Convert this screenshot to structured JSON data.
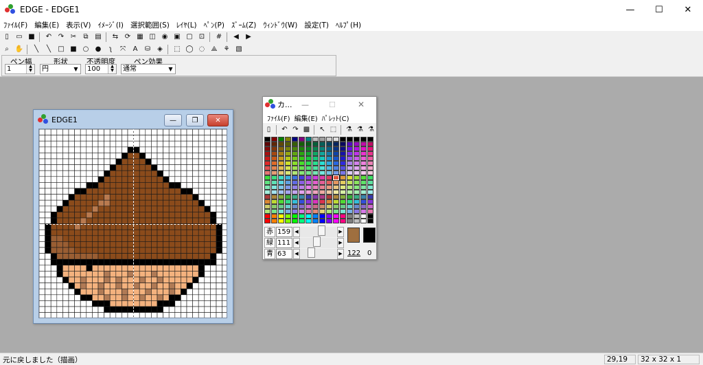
{
  "app": {
    "title": "EDGE - EDGE1",
    "minimize": "—",
    "maximize": "☐",
    "close": "✕"
  },
  "menu": [
    "ﾌｧｲﾙ(F)",
    "編集(E)",
    "表示(V)",
    "ｲﾒｰｼﾞ(I)",
    "選択範囲(S)",
    "ﾚｲﾔ(L)",
    "ﾍﾟﾝ(P)",
    "ｽﾞｰﾑ(Z)",
    "ｳｨﾝﾄﾞｳ(W)",
    "設定(T)",
    "ﾍﾙﾌﾟ(H)"
  ],
  "toolbar1": [
    {
      "name": "new-icon",
      "g": "▯"
    },
    {
      "name": "open-icon",
      "g": "▭"
    },
    {
      "name": "save-icon",
      "g": "■"
    },
    {
      "sep": true
    },
    {
      "name": "undo-icon",
      "g": "↶"
    },
    {
      "name": "redo-icon",
      "g": "↷"
    },
    {
      "name": "cut-icon",
      "g": "✂"
    },
    {
      "name": "copy-icon",
      "g": "⧉"
    },
    {
      "name": "paste-icon",
      "g": "▤"
    },
    {
      "sep": true
    },
    {
      "name": "flip-icon",
      "g": "⇆"
    },
    {
      "name": "rotate-icon",
      "g": "⟳"
    },
    {
      "name": "resize-icon",
      "g": "▦"
    },
    {
      "name": "layer-icon",
      "g": "◫"
    },
    {
      "name": "color-icon",
      "g": "◉"
    },
    {
      "name": "frame-icon",
      "g": "▣"
    },
    {
      "name": "preview-icon",
      "g": "▢"
    },
    {
      "name": "export-icon",
      "g": "⊡"
    },
    {
      "sep": true
    },
    {
      "name": "grid-icon",
      "g": "#"
    },
    {
      "sep": true
    },
    {
      "name": "prev-icon",
      "g": "◀"
    },
    {
      "name": "next-icon",
      "g": "▶"
    }
  ],
  "toolbar2": [
    {
      "name": "zoom-icon",
      "g": "⌕"
    },
    {
      "name": "hand-icon",
      "g": "✋"
    },
    {
      "sep": true
    },
    {
      "name": "pen-icon",
      "g": "╲"
    },
    {
      "name": "line-icon",
      "g": "╲"
    },
    {
      "name": "rect-icon",
      "g": "□"
    },
    {
      "name": "fill-rect-icon",
      "g": "■"
    },
    {
      "name": "ellipse-icon",
      "g": "○"
    },
    {
      "name": "fill-ellipse-icon",
      "g": "●"
    },
    {
      "name": "curve-icon",
      "g": "ʅ"
    },
    {
      "name": "spray-icon",
      "g": "⤧"
    },
    {
      "name": "text-icon",
      "g": "A"
    },
    {
      "name": "bucket-icon",
      "g": "⛁"
    },
    {
      "name": "eyedropper-icon",
      "g": "◈"
    },
    {
      "sep": true
    },
    {
      "name": "select-rect-icon",
      "g": "⬚"
    },
    {
      "name": "select-ellipse-icon",
      "g": "◯"
    },
    {
      "name": "lasso-icon",
      "g": "◌"
    },
    {
      "name": "polygon-select-icon",
      "g": "⟁"
    },
    {
      "name": "magic-wand-icon",
      "g": "⚘"
    },
    {
      "name": "select-color-icon",
      "g": "▧"
    }
  ],
  "props": {
    "width_label": "ペン幅",
    "width_value": "1",
    "shape_label": "形状",
    "shape_value": "円",
    "opacity_label": "不透明度",
    "opacity_value": "100",
    "effect_label": "ペン効果",
    "effect_value": "通常"
  },
  "child": {
    "title": "EDGE1",
    "minimize": "—",
    "restore": "❐",
    "close": "✕"
  },
  "pixel_colors": {
    "k": "#000000",
    "b": "#8b4b1b",
    "h": "#9a5e33",
    "s": "#b97a4f",
    "t": "#f4b27e",
    "d": "#b07a55",
    "w": "#ffffff"
  },
  "pixel_rows": [
    "................................",
    "................................",
    "................................",
    "...............kk...............",
    "..............kbbk..............",
    ".............kbbbbk.............",
    "............kbbbbbbk............",
    "...........kbbbbbbbbk...........",
    "..........kbbbbbbbbbbk..........",
    "........kkbbbbbbbbbbbbkk........",
    "......kkbbbbbbbbbbbbbbbbkk......",
    ".....kbbbbbsbbbbbbbbbbbbbbk.....",
    "....kbbbbbssbbbbbbbbbbbbbbbk....",
    "...kbbbbbsbbbbbbbbbbbbbbbbbbk...",
    "..kbbbbbsbbbbbbbbbbbbbbbbbbbbk..",
    "..kbbbbsbbbbbbbbbbbbbbbbbbbbbk..",
    ".kbbbbsbbbbbbbbbbbbbbbbbbbbbbbk.",
    ".kbbbbbbbbbbbbbbbbbbbbbbbbbbbbk.",
    ".khhbbbbbbbbbbbbbbbbbbbbbbbbbbk.",
    ".khhhbbbbbbbbbbbbbbbbbbbbbbbbbk.",
    ".khhhhbbbbbbbbbbbbbbbbbbbbbbbbk.",
    "..khhhhhhhbbbbbbbbbbbbbbbbbbbk..",
    "..kkkkkkkkkkkkkkkkkkkkkkkkkkkk..",
    "...kttttkttttttttttttttttttk....",
    "...ktttttttdtttdtttdtttttttk....",
    "....kttdtttdtdtttdttdtttttk.....",
    ".....ktdttdttdttdttdttdttk......",
    "......ktttdtttdtttdtttdtk.......",
    ".......kkttdttdttdttdtkk........",
    ".........kkkttttttttkkk.........",
    "...........kkkkkkkkkk...........",
    "................................"
  ],
  "palette": {
    "title": "カ...",
    "menu": [
      "ﾌｧｲﾙ(F)",
      "編集(E)",
      "ﾊﾟﾚｯﾄ(C)"
    ],
    "toolbar": [
      {
        "name": "pal-new-icon",
        "g": "▯"
      },
      {
        "sep": true
      },
      {
        "name": "pal-undo-icon",
        "g": "↶"
      },
      {
        "name": "pal-redo-icon",
        "g": "↷"
      },
      {
        "name": "pal-gradient-icon",
        "g": "▩"
      },
      {
        "sep": true
      },
      {
        "name": "pal-pointer-icon",
        "g": "↖"
      },
      {
        "name": "pal-select-icon",
        "g": "⬚"
      },
      {
        "sep": true
      },
      {
        "name": "pal-mix1-icon",
        "g": "⚗"
      },
      {
        "name": "pal-mix2-icon",
        "g": "⚗"
      },
      {
        "name": "pal-mix3-icon",
        "g": "⚗"
      }
    ],
    "r_label": "赤",
    "r_value": "159",
    "r_level": 0.62,
    "g_label": "緑",
    "g_value": "111",
    "g_level": 0.44,
    "b_label": "青",
    "b_value": "63",
    "b_level": 0.25,
    "fg_color": "#9f6f3f",
    "bg_color": "#000000",
    "fg_index": "122",
    "bg_index": "0"
  },
  "status": {
    "message": "元に戻しました（描画）",
    "coords": "29,19",
    "size": "32 x 32 x 1"
  }
}
